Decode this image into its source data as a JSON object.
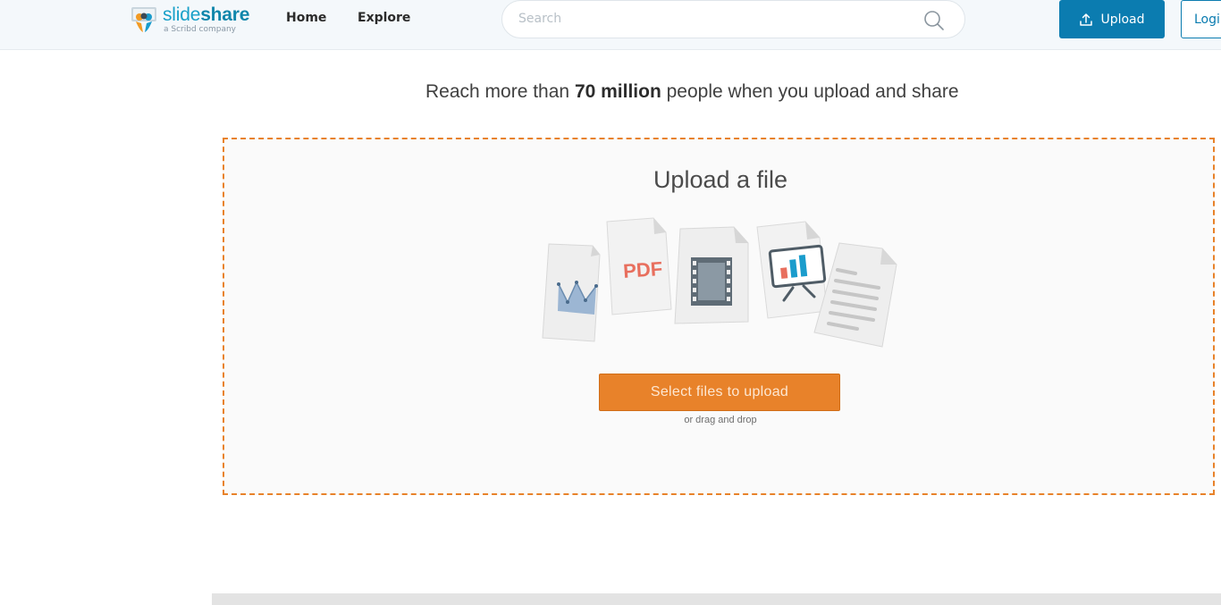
{
  "header": {
    "logo": {
      "word_light": "slide",
      "word_bold": "share",
      "tagline": "a Scribd company"
    },
    "nav": [
      {
        "label": "Home"
      },
      {
        "label": "Explore"
      }
    ],
    "search": {
      "placeholder": "Search",
      "icon": "search-icon"
    },
    "upload_button": {
      "label": "Upload",
      "icon": "upload-icon"
    },
    "login_button": {
      "label": "Login"
    }
  },
  "main": {
    "tagline": {
      "prefix": "Reach more than ",
      "highlight": "70 million",
      "suffix": " people when you upload and share"
    },
    "dropzone": {
      "title": "Upload a file",
      "illustration_text": "PDF",
      "select_button": "Select files to upload",
      "drag_hint": "or drag and drop"
    }
  },
  "colors": {
    "brand_blue": "#0b7cb0",
    "accent_orange": "#e8822a",
    "header_bg": "#f4f8fb"
  }
}
